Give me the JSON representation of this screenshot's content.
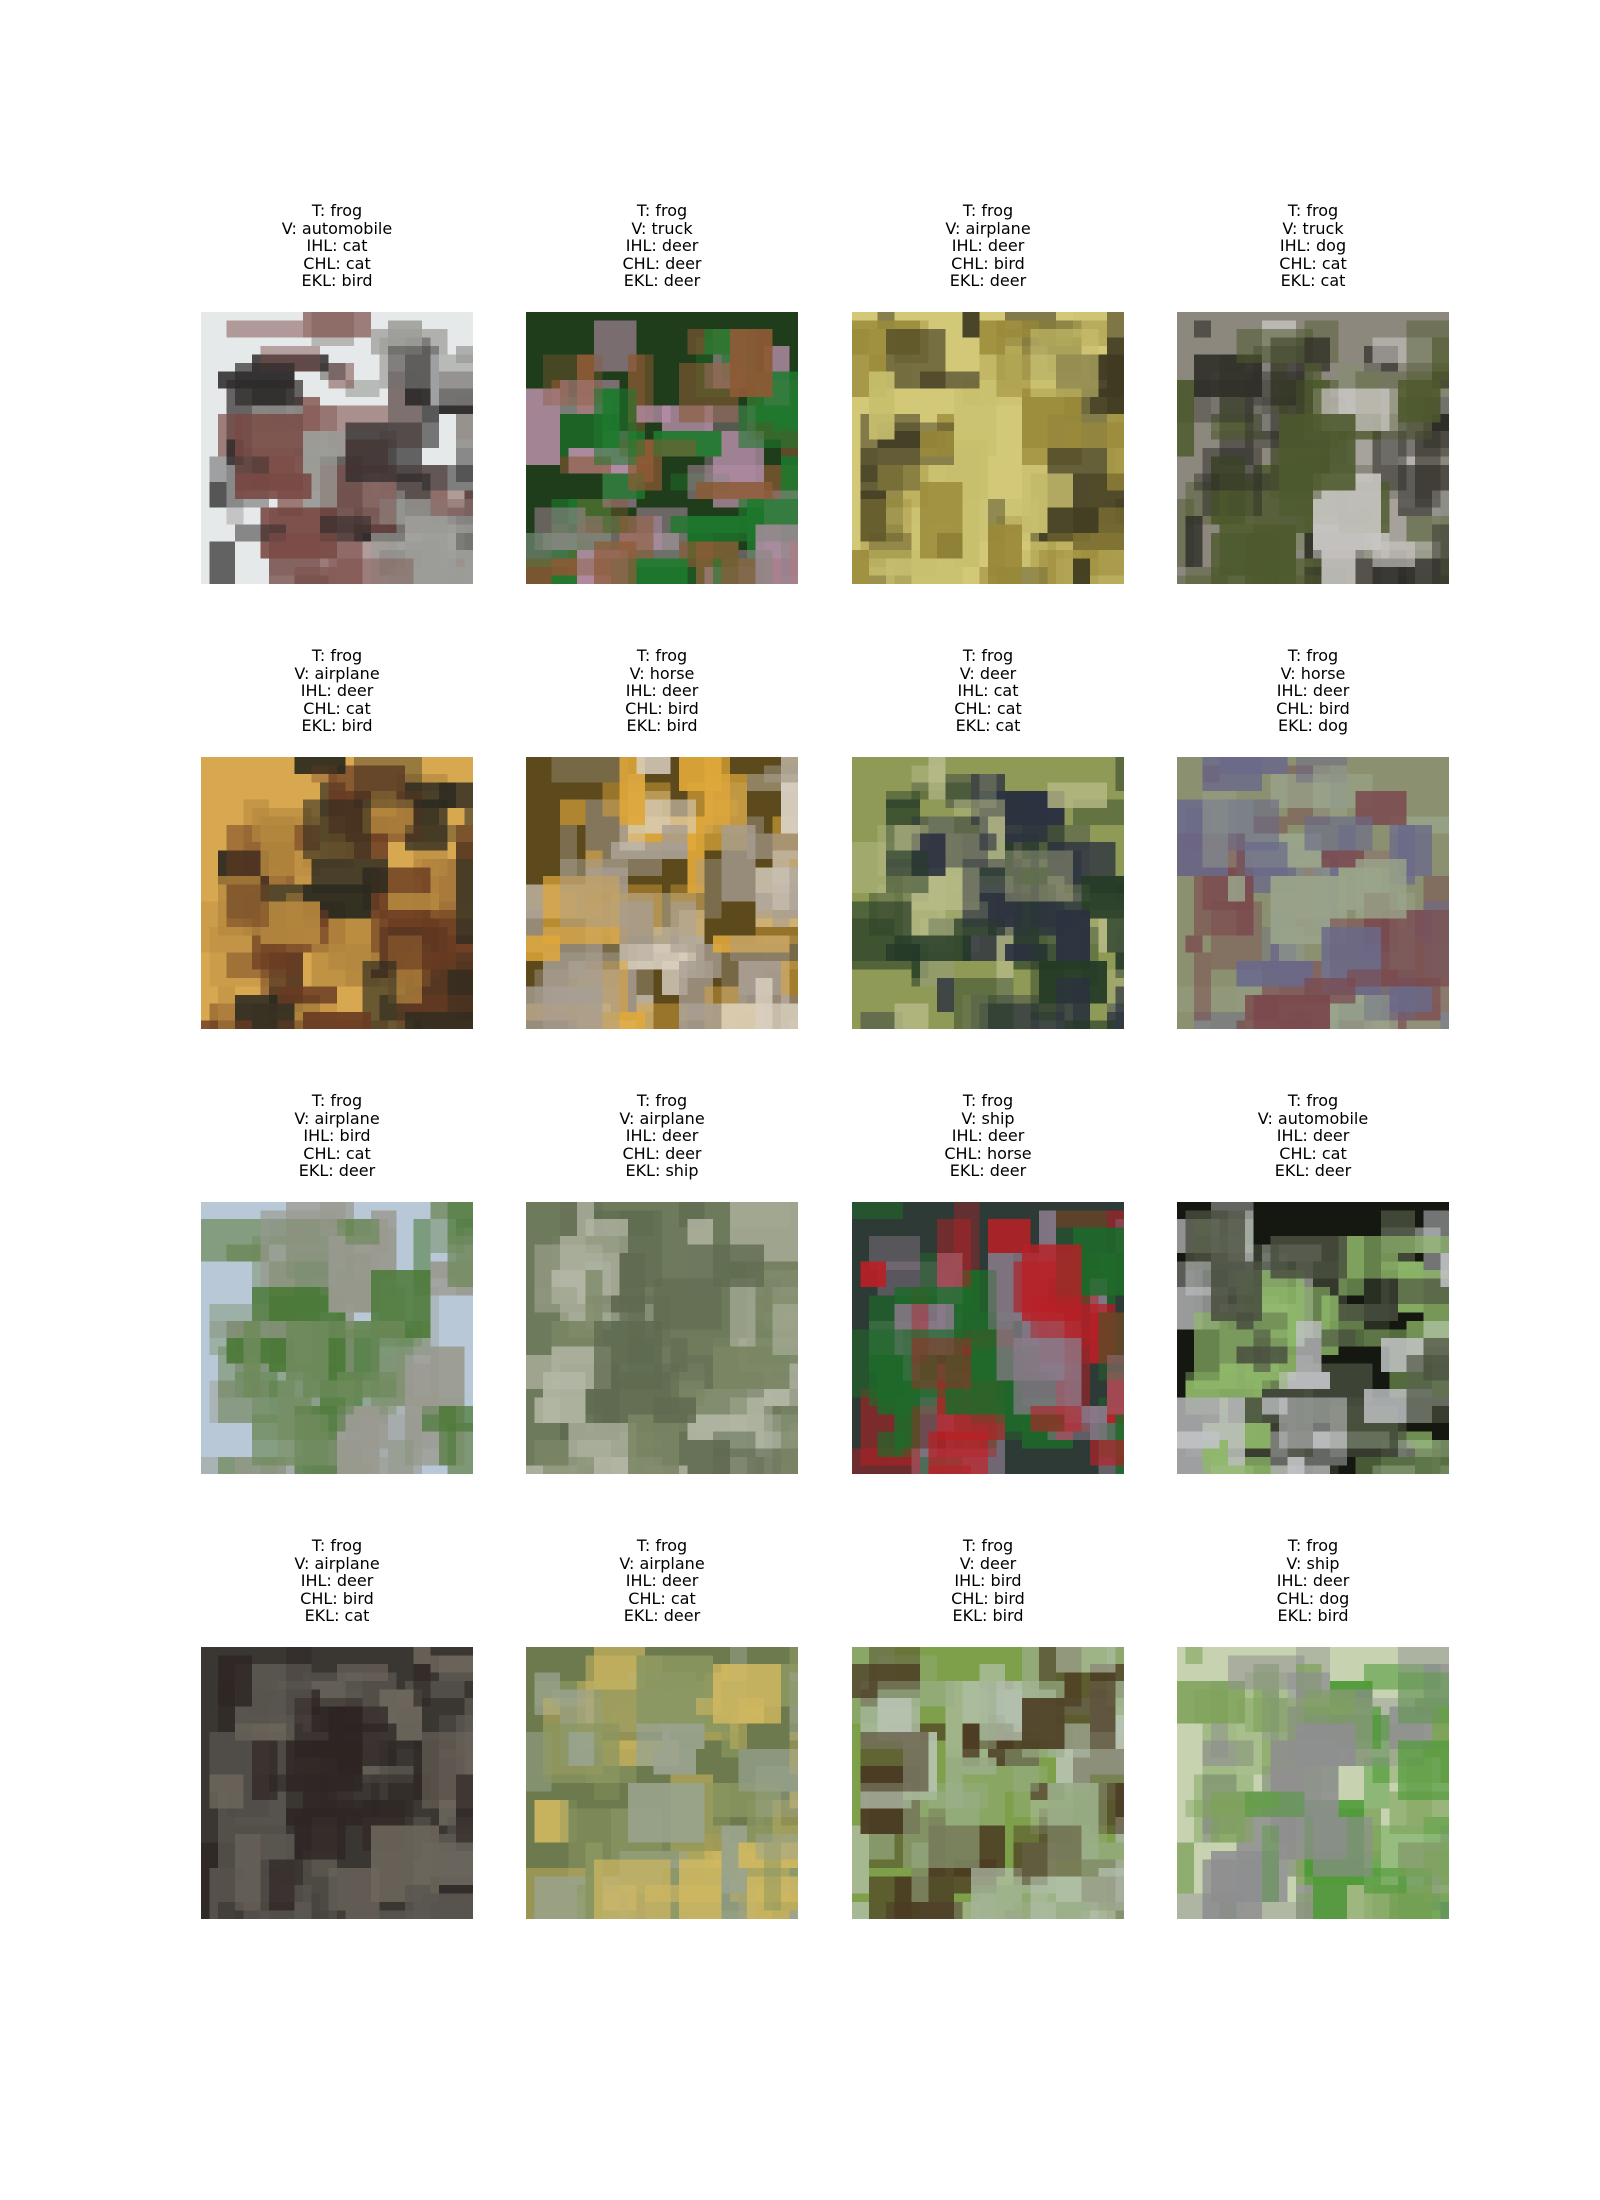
{
  "figure": {
    "panels": [
      {
        "true": "T: frog",
        "v": "V: automobile",
        "ihl": "IHL: cat",
        "chl": "CHL: cat",
        "ekl": "EKL: bird",
        "image_colors": [
          "#e6e9ea",
          "#9c9c98",
          "#2d2a2a",
          "#7a4a45"
        ]
      },
      {
        "true": "T: frog",
        "v": "V: truck",
        "ihl": "IHL: deer",
        "chl": "CHL: deer",
        "ekl": "EKL: deer",
        "image_colors": [
          "#1f3d1a",
          "#1e7a2e",
          "#8c5a35",
          "#b58ea8"
        ]
      },
      {
        "true": "T: frog",
        "v": "V: airplane",
        "ihl": "IHL: deer",
        "chl": "CHL: bird",
        "ekl": "EKL: deer",
        "image_colors": [
          "#d2c878",
          "#c8bf6e",
          "#3f3a22",
          "#9a8a3a"
        ]
      },
      {
        "true": "T: frog",
        "v": "V: truck",
        "ihl": "IHL: dog",
        "chl": "CHL: cat",
        "ekl": "EKL: cat",
        "image_colors": [
          "#8d887e",
          "#c9c6c3",
          "#2c2b26",
          "#4e5a2e"
        ]
      },
      {
        "true": "T: frog",
        "v": "V: airplane",
        "ihl": "IHL: deer",
        "chl": "CHL: cat",
        "ekl": "EKL: bird",
        "image_colors": [
          "#d8a850",
          "#6a3c22",
          "#b5883f",
          "#2c2a20"
        ]
      },
      {
        "true": "T: frog",
        "v": "V: horse",
        "ihl": "IHL: deer",
        "chl": "CHL: bird",
        "ekl": "EKL: bird",
        "image_colors": [
          "#5c4a1c",
          "#e0a83a",
          "#d8cfc0",
          "#a89e92"
        ]
      },
      {
        "true": "T: frog",
        "v": "V: deer",
        "ihl": "IHL: cat",
        "chl": "CHL: cat",
        "ekl": "EKL: cat",
        "image_colors": [
          "#8e9a55",
          "#243a26",
          "#b6b986",
          "#2c3240"
        ]
      },
      {
        "true": "T: frog",
        "v": "V: horse",
        "ihl": "IHL: deer",
        "chl": "CHL: bird",
        "ekl": "EKL: dog",
        "image_colors": [
          "#8b9070",
          "#6a6a8a",
          "#7a4a4e",
          "#9aa48a"
        ]
      },
      {
        "true": "T: frog",
        "v": "V: airplane",
        "ihl": "IHL: bird",
        "chl": "CHL: cat",
        "ekl": "EKL: deer",
        "image_colors": [
          "#b8c8d6",
          "#4d7a3a",
          "#6f8a5c",
          "#9a9a90"
        ]
      },
      {
        "true": "T: frog",
        "v": "V: airplane",
        "ihl": "IHL: deer",
        "chl": "CHL: deer",
        "ekl": "EKL: ship",
        "image_colors": [
          "#6e7a5c",
          "#7a8664",
          "#b2b6a4",
          "#5f6a50"
        ]
      },
      {
        "true": "T: frog",
        "v": "V: ship",
        "ihl": "IHL: deer",
        "chl": "CHL: horse",
        "ekl": "EKL: deer",
        "image_colors": [
          "#2e3a36",
          "#b82026",
          "#1f6a2a",
          "#8a7a8a"
        ]
      },
      {
        "true": "T: frog",
        "v": "V: automobile",
        "ihl": "IHL: deer",
        "chl": "CHL: cat",
        "ekl": "EKL: deer",
        "image_colors": [
          "#141810",
          "#8fb86a",
          "#4a5040",
          "#c0c2c4"
        ]
      },
      {
        "true": "T: frog",
        "v": "V: airplane",
        "ihl": "IHL: deer",
        "chl": "CHL: bird",
        "ekl": "EKL: cat",
        "image_colors": [
          "#3a3632",
          "#5a5650",
          "#2e2624",
          "#6c665c"
        ]
      },
      {
        "true": "T: frog",
        "v": "V: airplane",
        "ihl": "IHL: deer",
        "chl": "CHL: cat",
        "ekl": "EKL: deer",
        "image_colors": [
          "#6c7a4e",
          "#8a9660",
          "#9aa490",
          "#d0b860"
        ]
      },
      {
        "true": "T: frog",
        "v": "V: deer",
        "ihl": "IHL: bird",
        "chl": "CHL: bird",
        "ekl": "EKL: bird",
        "image_colors": [
          "#7fa04a",
          "#9aae88",
          "#4a3a22",
          "#b6c2b0"
        ]
      },
      {
        "true": "T: frog",
        "v": "V: ship",
        "ihl": "IHL: deer",
        "chl": "CHL: dog",
        "ekl": "EKL: bird",
        "image_colors": [
          "#c6d2b0",
          "#4f9a38",
          "#7ea25a",
          "#8e8e90"
        ]
      }
    ]
  }
}
